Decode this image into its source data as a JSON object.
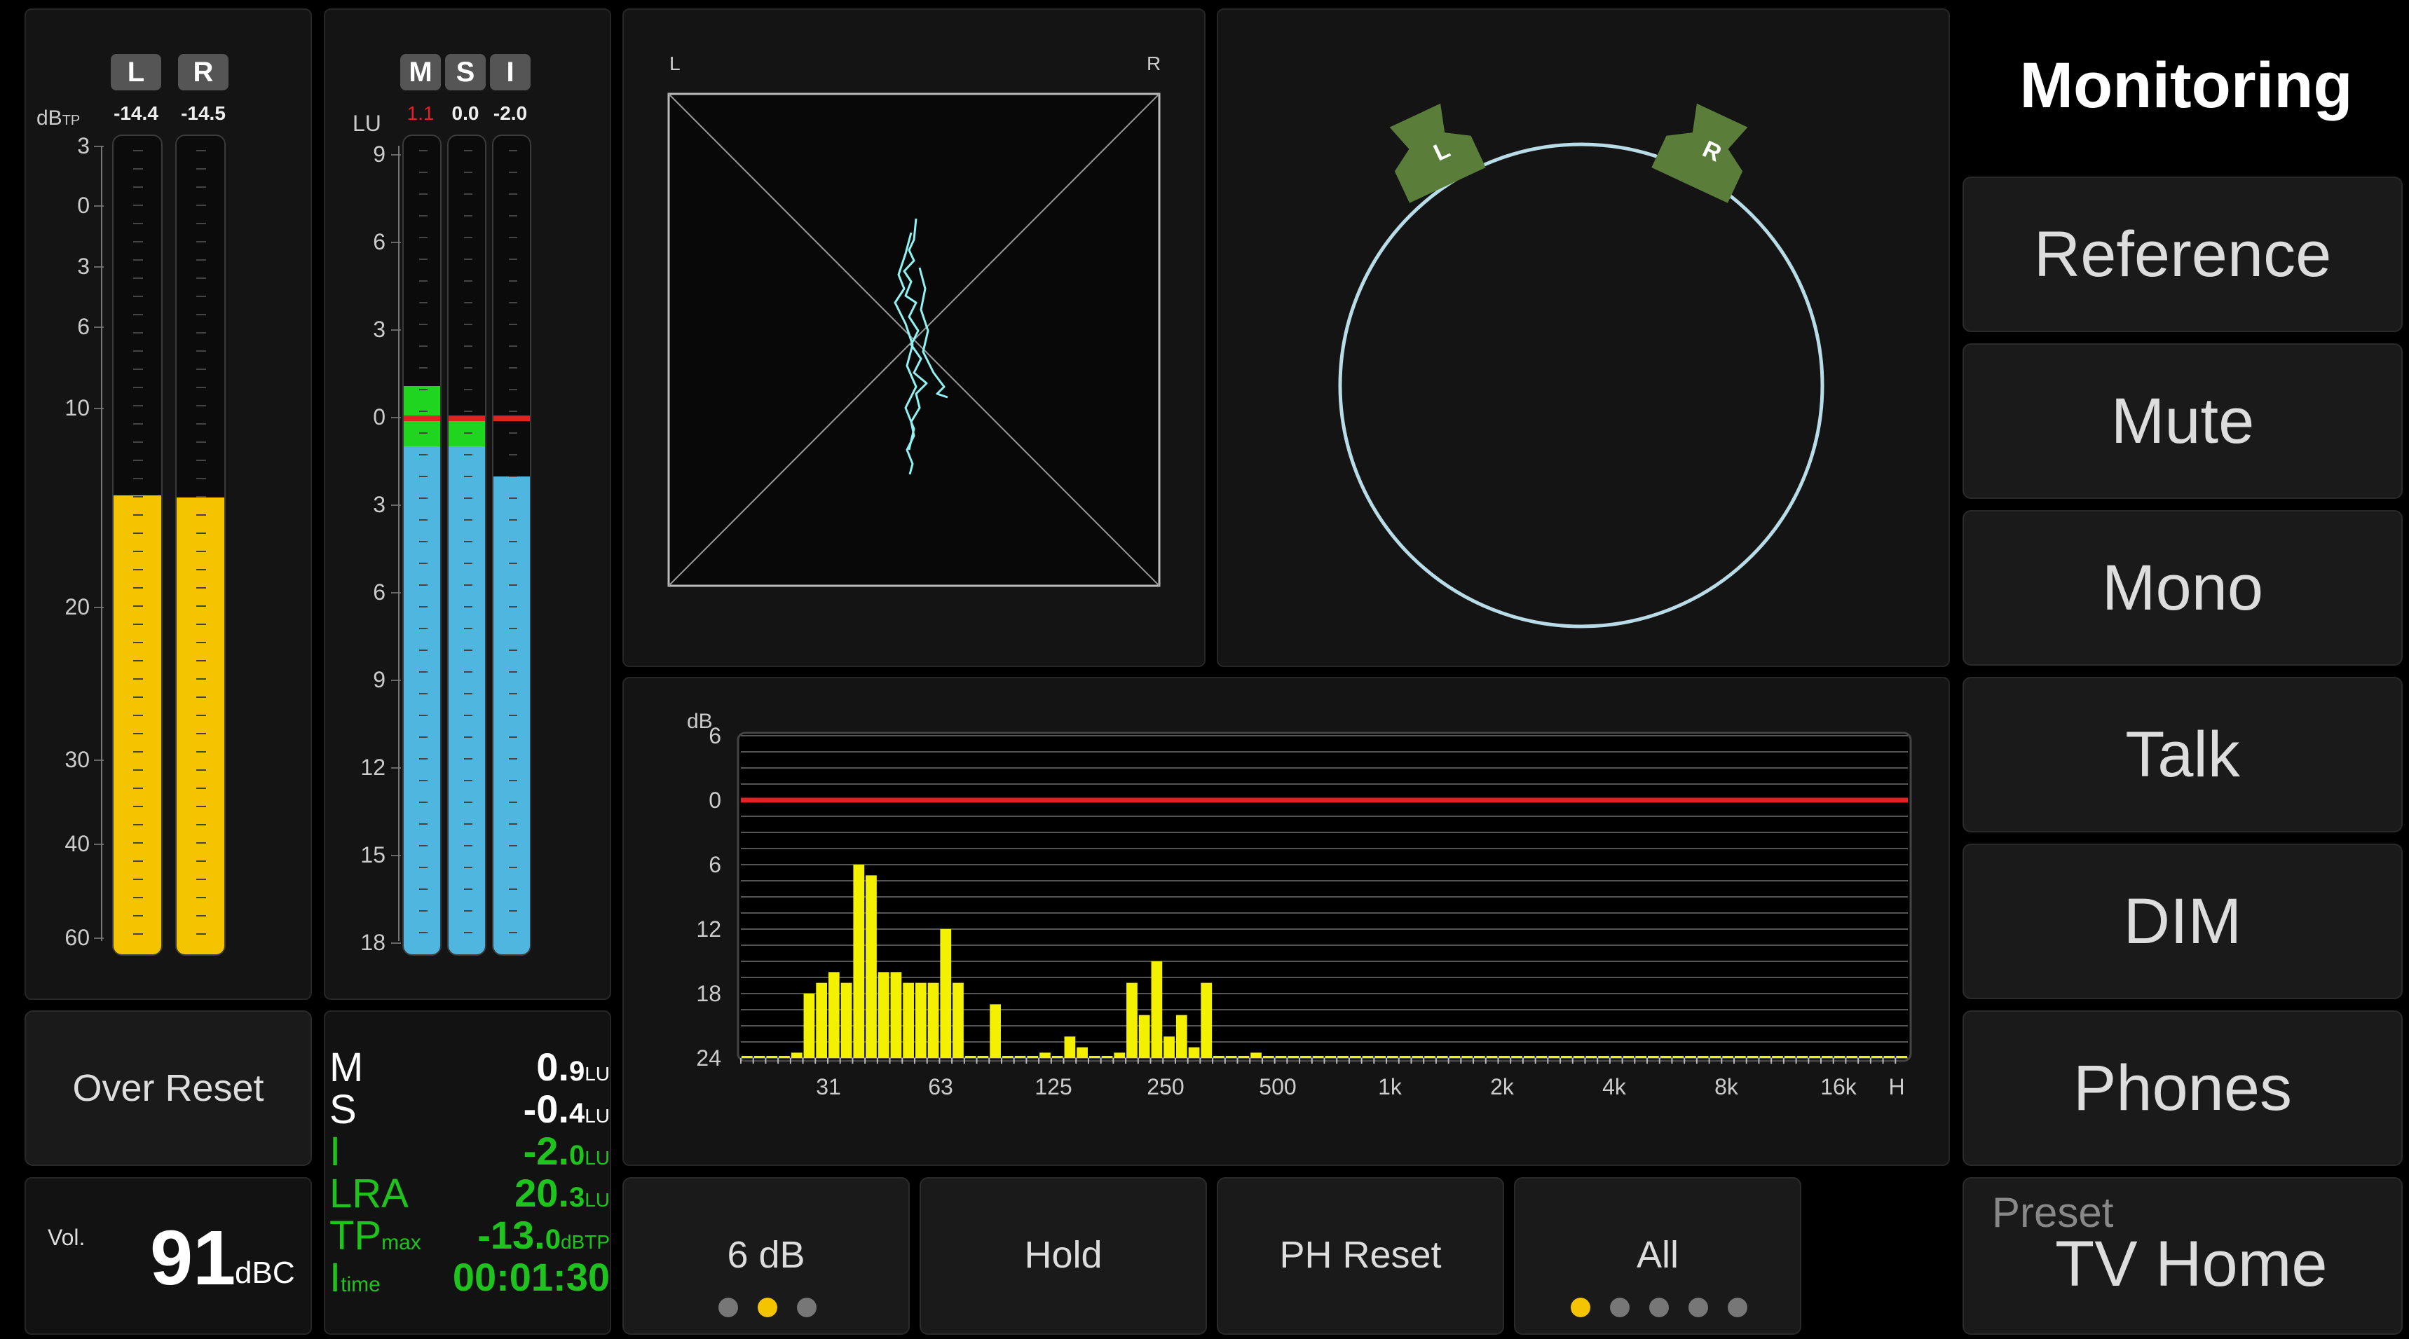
{
  "colors": {
    "accent_yellow": "#f5c400",
    "meter_blue": "#4fb6e0",
    "meter_green": "#1fd51f",
    "loudness_green": "#1ec31e",
    "over_red": "#e22222",
    "spectrum_yellow": "#f3f000",
    "scope_trace": "#8ff3f3",
    "speaker_green": "#5a7d3a"
  },
  "peak_meter": {
    "unit": "dB",
    "unit_sub": "TP",
    "channels": [
      {
        "label": "L",
        "value": "-14.4",
        "level": -14.4
      },
      {
        "label": "R",
        "value": "-14.5",
        "level": -14.5
      }
    ],
    "scale": [
      "3",
      "0",
      "3",
      "6",
      "10",
      "20",
      "30",
      "40",
      "60"
    ]
  },
  "loudness_meter": {
    "unit": "LU",
    "channels": [
      {
        "label": "M",
        "value": "1.1",
        "value_color": "#e22222",
        "level": 1.1
      },
      {
        "label": "S",
        "value": "0.0",
        "value_color": "#eeeeee",
        "level": 0.0
      },
      {
        "label": "I",
        "value": "-2.0",
        "value_color": "#eeeeee",
        "level": -2.0
      }
    ],
    "scale": [
      "9",
      "6",
      "3",
      "0",
      "3",
      "6",
      "9",
      "12",
      "15",
      "18"
    ]
  },
  "goniometer": {
    "left_label": "L",
    "right_label": "R"
  },
  "surround": {
    "left_speaker": "L",
    "right_speaker": "R"
  },
  "chart_data": {
    "type": "bar",
    "ylabel": "dB",
    "y_ticks": [
      "6",
      "0",
      "6",
      "12",
      "18",
      "24"
    ],
    "x_ticks": [
      "31",
      "63",
      "125",
      "250",
      "500",
      "1k",
      "2k",
      "4k",
      "8k",
      "16k",
      "H"
    ],
    "reference_line": 0,
    "values": [
      24,
      24,
      24,
      24,
      23.5,
      18,
      17,
      16,
      17,
      6,
      7,
      16,
      16,
      17,
      17,
      17,
      12,
      17,
      24,
      24,
      19,
      24,
      23.8,
      24,
      23.5,
      24,
      22,
      23,
      24,
      24,
      23.5,
      17,
      20,
      15,
      22,
      20,
      23,
      17,
      24,
      24,
      24,
      23.5,
      24,
      24,
      24,
      24,
      24,
      24,
      24,
      24,
      24,
      24,
      24,
      24,
      24,
      24,
      24,
      24,
      24,
      24,
      24,
      24,
      24,
      24,
      24,
      24,
      24,
      24,
      24,
      24,
      24,
      24,
      24,
      24,
      24,
      24,
      24,
      24,
      24,
      24,
      24,
      24,
      24,
      24,
      24,
      24,
      24,
      24,
      24,
      24,
      24,
      24,
      24,
      24
    ]
  },
  "loudness_summary": [
    {
      "key": "M",
      "sub": "",
      "value": "0.",
      "dec": "9",
      "unit": "LU",
      "color": "#ffffff"
    },
    {
      "key": "S",
      "sub": "",
      "value": "-0.",
      "dec": "4",
      "unit": "LU",
      "color": "#ffffff"
    },
    {
      "key": "I",
      "sub": "",
      "value": "-2.",
      "dec": "0",
      "unit": "LU",
      "color": "#1ec31e"
    },
    {
      "key": "LRA",
      "sub": "",
      "value": "20.",
      "dec": "3",
      "unit": "LU",
      "color": "#1ec31e"
    },
    {
      "key": "TP",
      "sub": "max",
      "value": "-13.",
      "dec": "0",
      "unit": "dBTP",
      "color": "#1ec31e"
    },
    {
      "key": "I",
      "sub": "time",
      "value": "00:01:30",
      "dec": "",
      "unit": "",
      "color": "#1ec31e"
    }
  ],
  "over_reset": "Over Reset",
  "volume": {
    "label": "Vol.",
    "value": "91",
    "unit": "dBC"
  },
  "bottom_buttons": [
    {
      "label": "6 dB",
      "dots": 3,
      "active_dot": 1
    },
    {
      "label": "Hold",
      "dots": 0,
      "active_dot": -1
    },
    {
      "label": "PH Reset",
      "dots": 0,
      "active_dot": -1
    },
    {
      "label": "All",
      "dots": 5,
      "active_dot": 0
    }
  ],
  "sidebar": {
    "title": "Monitoring",
    "buttons": [
      "Reference",
      "Mute",
      "Mono",
      "Talk",
      "DIM",
      "Phones"
    ],
    "preset_label": "Preset",
    "preset_value": "TV Home"
  }
}
